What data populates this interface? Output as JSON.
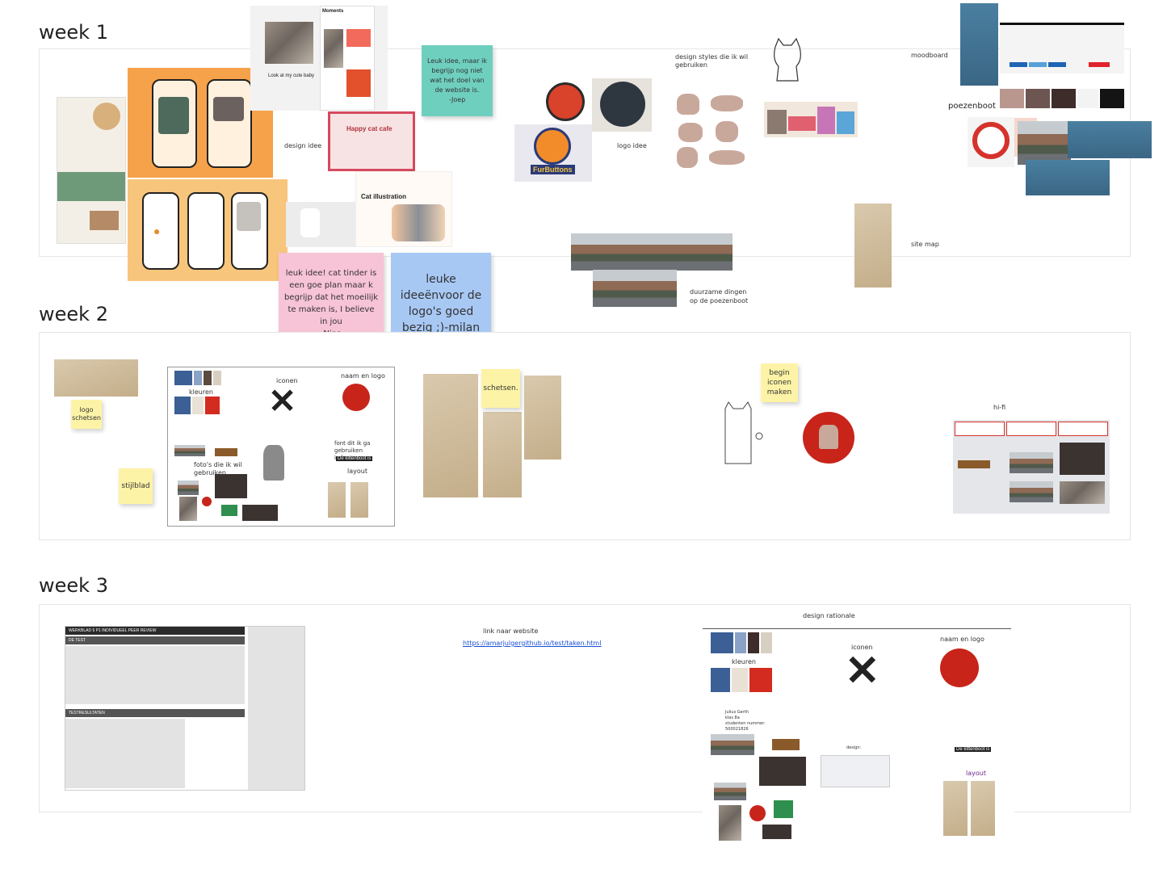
{
  "weeks": {
    "w1": "week 1",
    "w2": "week 2",
    "w3": "week 3"
  },
  "week1": {
    "moments_title": "Moments",
    "cute_caption": "Look at my cute baby",
    "happy_cafe": "Happy cat cafe",
    "cat_illustration": "Cat illustration",
    "design_idee": "design idee",
    "logo_idee": "logo idee",
    "design_styles": "design styles die ik wil\ngebruiken",
    "moodboard": "moodboard",
    "poezenboot": "poezenboot",
    "site_map": "site map",
    "duurzame": "duurzame dingen\nop de poezenboot",
    "furbuttons": "FurButtons",
    "sticky_teal": "Leuk idee, maar ik begrijp nog niet wat het doel van de website is.\n-Joep",
    "sticky_pink": "leuk idee! cat tinder is een goe plan maar k begrijp dat het moeilijk te maken is, I believe in jou\n-Nina",
    "sticky_blue": "leuke ideeënvoor de logo's goed bezig ;)-milan"
  },
  "week2": {
    "logo_schetsen": "logo\nschetsen",
    "stijlblad": "stijlblad",
    "kleuren": "kleuren",
    "iconen": "iconen",
    "naam_en_logo": "naam en logo",
    "fotos": "foto's die ik wil\ngebruiken",
    "font_label": "font dit ik ga gebruiken\nis fantaasy",
    "font_sample": "De kittenboot is",
    "layout": "layout",
    "schetsen": "schetsen.",
    "begin_iconen": "begin\niconen\nmaken",
    "hifi": "hi-fi"
  },
  "week3": {
    "peer_review_title": "WERKBLAD 5 P1 INDIVIDUEEL PEER REVIEW",
    "de_test": "DE TEST",
    "testresultaten": "TESTRESULTATEN",
    "link_label": "link naar website",
    "link_url": "https://amarjulgergithub.io/test/taken.html",
    "design_rationale": "design rationale",
    "kleuren": "kleuren",
    "iconen": "iconen",
    "naam_en_logo": "naam en logo",
    "layout": "layout",
    "font_sample": "De kittenboot is",
    "student_info": "Julius Gerth\nklas 8a\nstudenten nummer:\n500021826",
    "design_label": "design:"
  },
  "colors": {
    "teal_sticky": "#6fcfbf",
    "pink_sticky": "#f7c3d6",
    "blue_sticky": "#a8c8f4",
    "yellow_sticky": "#fdf3a6",
    "swatch_blue": "#3c5f95",
    "swatch_red": "#d32b1f",
    "swatch_brown": "#5a4a40"
  }
}
